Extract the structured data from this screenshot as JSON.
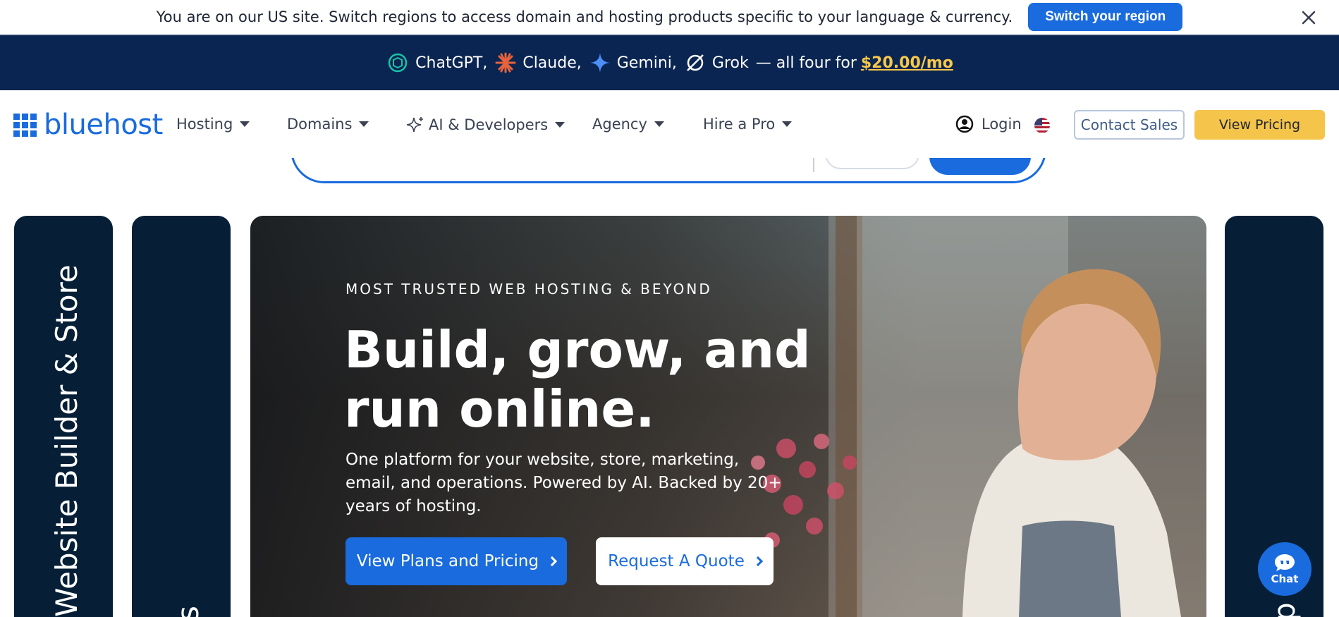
{
  "region_bar": {
    "message": "You are on our US site. Switch regions to access domain and hosting products specific to your language & currency.",
    "switch_label": "Switch your region"
  },
  "promo": {
    "items": [
      "ChatGPT,",
      "Claude,",
      "Gemini,",
      "Grok"
    ],
    "suffix": "— all four for",
    "price": "$20.00/mo"
  },
  "nav": {
    "brand": "bluehost",
    "items": [
      {
        "label": "Hosting"
      },
      {
        "label": "Domains"
      },
      {
        "label": "AI & Developers"
      },
      {
        "label": "Agency"
      },
      {
        "label": "Hire a Pro"
      }
    ],
    "login": "Login",
    "contact_sales": "Contact Sales",
    "view_pricing": "View Pricing"
  },
  "side_cards": {
    "left_label": "Website Builder & Store",
    "second_label": "s",
    "right_label": "p"
  },
  "hero": {
    "eyebrow": "MOST TRUSTED WEB HOSTING & BEYOND",
    "headline": "Build, grow, and run online.",
    "subtext": "One platform for your website, store, marketing, email, and operations. Powered by AI. Backed by 20+ years of hosting.",
    "primary_cta": "View Plans and Pricing",
    "secondary_cta": "Request A Quote"
  },
  "chat": {
    "label": "Chat"
  },
  "colors": {
    "brand_blue": "#196bde",
    "promo_bg": "#0a2552",
    "card_navy": "#061f37",
    "pricing_yellow": "#f5c44a",
    "price_gold": "#f9c84a"
  }
}
